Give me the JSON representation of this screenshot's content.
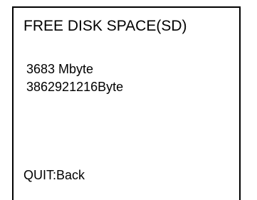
{
  "screen": {
    "title": "FREE DISK SPACE(SD)",
    "free_megabytes": "3683 Mbyte",
    "free_bytes": "3862921216Byte",
    "quit_hint": "QUIT:Back"
  }
}
